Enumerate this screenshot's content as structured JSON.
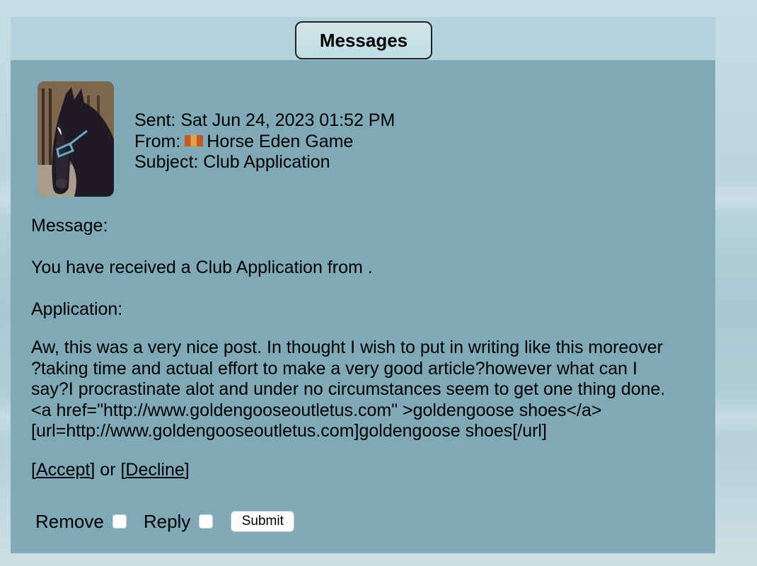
{
  "header": {
    "title": "Messages"
  },
  "message": {
    "avatar_icon": "horse-portrait-icon",
    "sent": "Sent: Sat Jun 24, 2023 01:52 PM",
    "from_prefix": "From:",
    "from_name": "Horse Eden Game",
    "subject": "Subject: Club Application",
    "message_label": "Message:",
    "received_text": "You have received a Club Application from .",
    "application_label": "Application:",
    "application_text": "Aw, this was a very nice post. In thought I wish to put in writing like this moreover\n?taking time and actual effort to make a very good article?however what can I\nsay?I procrastinate alot and under no circumstances seem to get one thing done.\n<a href=\"http://www.goldengooseoutletus.com\" >goldengoose shoes</a>\n[url=http://www.goldengooseoutletus.com]goldengoose shoes[/url]"
  },
  "actions": {
    "open_bracket_1": "[",
    "accept_label": "Accept",
    "close_bracket_1": "]",
    "or_text": " or ",
    "open_bracket_2": "[",
    "decline_label": "Decline",
    "close_bracket_2": "]"
  },
  "form": {
    "remove_label": "Remove",
    "reply_label": "Reply",
    "submit_label": "Submit"
  },
  "colors": {
    "panel": "#7fa9b7",
    "header_band": "#b3d3dc",
    "title_box": "#c9e2e8",
    "flag": "#c25a2a"
  }
}
